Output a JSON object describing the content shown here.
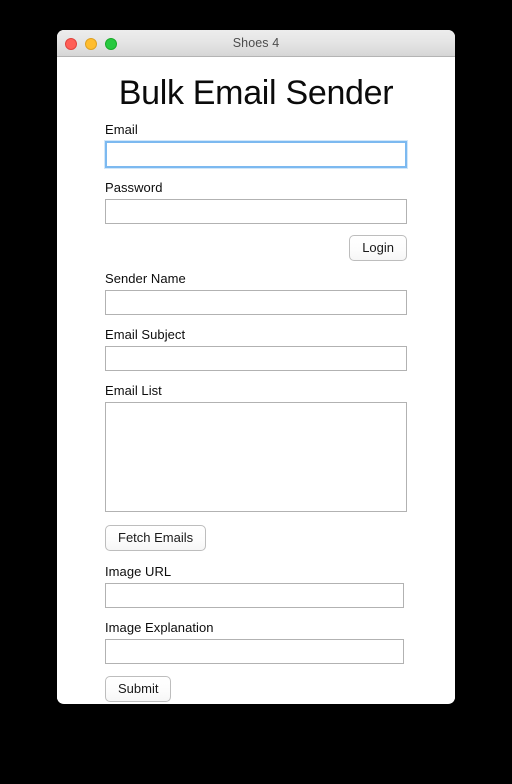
{
  "window": {
    "title": "Shoes 4",
    "traffic_lights": [
      {
        "name": "close-button",
        "color": "#ff5f57"
      },
      {
        "name": "minimize-button",
        "color": "#ffbd2e"
      },
      {
        "name": "maximize-button",
        "color": "#28c940"
      }
    ]
  },
  "page": {
    "heading": "Bulk Email Sender"
  },
  "form": {
    "email": {
      "label": "Email",
      "value": "",
      "placeholder": "",
      "focused": true
    },
    "password": {
      "label": "Password",
      "value": "",
      "placeholder": "",
      "focused": false
    },
    "login_button": "Login",
    "sender_name": {
      "label": "Sender Name",
      "value": "",
      "placeholder": ""
    },
    "email_subject": {
      "label": "Email Subject",
      "value": "",
      "placeholder": ""
    },
    "email_list": {
      "label": "Email List",
      "value": "",
      "placeholder": ""
    },
    "fetch_emails_button": "Fetch Emails",
    "image_url": {
      "label": "Image URL",
      "value": "",
      "placeholder": ""
    },
    "image_explanation": {
      "label": "Image Explanation",
      "value": "",
      "placeholder": ""
    },
    "submit_button": "Submit"
  },
  "colors": {
    "focus_border": "#7cb9f0",
    "input_border": "#b2b2b2",
    "desktop_background": "#000000",
    "window_background": "#ffffff",
    "titlebar_top": "#ededed",
    "titlebar_bottom": "#d6d6d6",
    "title_text": "#4d4d4d"
  }
}
